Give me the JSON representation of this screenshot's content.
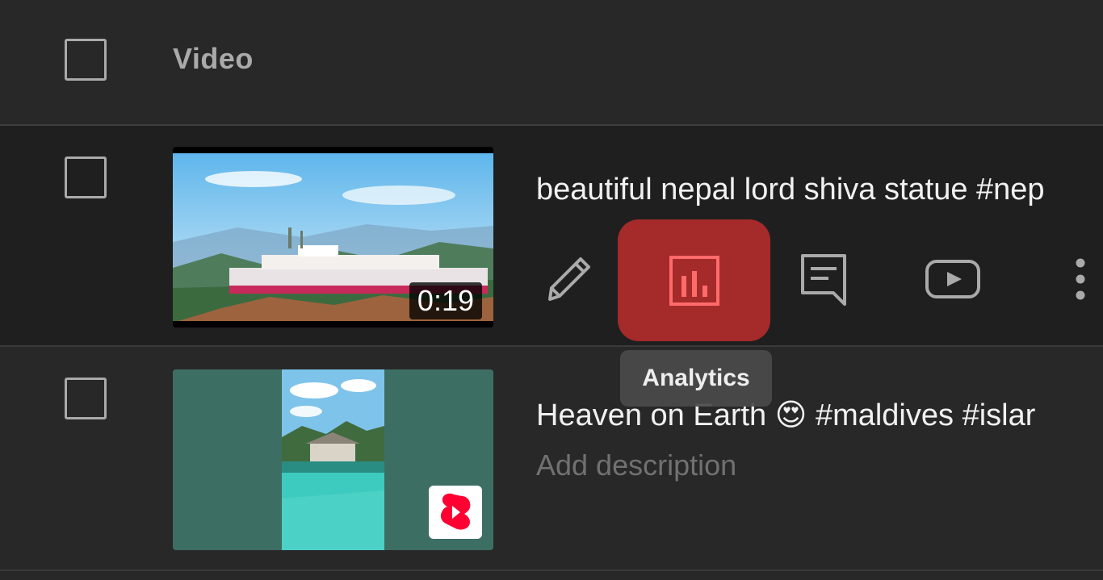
{
  "table": {
    "header_label": "Video"
  },
  "rows": [
    {
      "title": "beautiful nepal lord shiva statue #nep",
      "duration": "0:19"
    },
    {
      "title_text": "Heaven on Earth",
      "emoji": "😍",
      "title_tags": "#maldives #islar",
      "description_placeholder": "Add description"
    }
  ],
  "actions": {
    "edit_icon": "pencil-icon",
    "analytics_icon": "bar-chart-icon",
    "comments_icon": "comment-icon",
    "youtube_icon": "play-icon",
    "more_icon": "kebab-icon"
  },
  "tooltip": {
    "label": "Analytics"
  },
  "colors": {
    "active_action_bg": "#a52a2a",
    "shorts_badge": "#ff0033"
  }
}
